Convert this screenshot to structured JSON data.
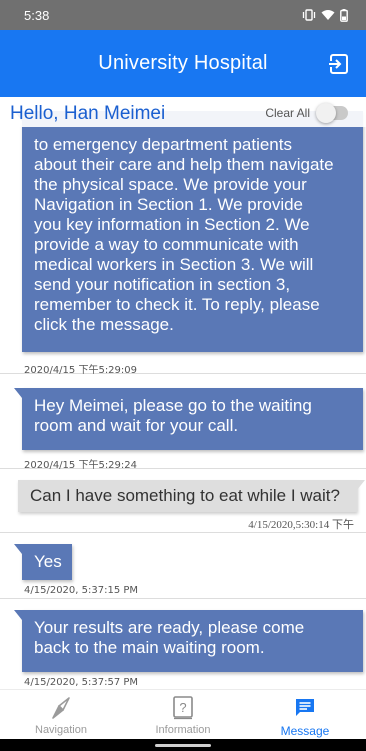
{
  "status_bar": {
    "time": "5:38"
  },
  "header": {
    "title": "University Hospital"
  },
  "greeting": "Hello, Han Meimei",
  "clear_all_label": "Clear All",
  "messages": [
    {
      "direction": "in",
      "lines": [
        "to emergency department patients",
        "about their care and help them navigate",
        "the physical space. We provide your",
        "Navigation in Section 1. We provide",
        "you key information in Section 2. We",
        "provide a way to communicate with",
        "medical workers in Section 3. We will",
        "send your notification in section 3,",
        "remember to check it. To reply, please",
        "click the message."
      ],
      "timestamp": "2020/4/15 下午5:29:09"
    },
    {
      "direction": "in",
      "lines": [
        "Hey Meimei, please go to the waiting",
        "room and wait for your call."
      ],
      "timestamp": "2020/4/15 下午5:29:24"
    },
    {
      "direction": "out",
      "lines": [
        "Can I have something to eat while I wait?"
      ],
      "timestamp": "4/15/2020,5:30:14 下午"
    },
    {
      "direction": "in",
      "lines": [
        "Yes"
      ],
      "timestamp": "4/15/2020, 5:37:15 PM"
    },
    {
      "direction": "in",
      "lines": [
        "Your results are ready, please come",
        "back to the main waiting room."
      ],
      "timestamp": "4/15/2020, 5:37:57 PM"
    }
  ],
  "bottom_nav": [
    {
      "label": "Navigation",
      "icon": "compass-icon",
      "active": false
    },
    {
      "label": "Information",
      "icon": "question-icon",
      "active": false
    },
    {
      "label": "Message",
      "icon": "message-icon",
      "active": true
    }
  ],
  "colors": {
    "primary": "#1877f2",
    "incoming_bubble": "#5a78b6",
    "outgoing_bubble": "#dedede"
  }
}
